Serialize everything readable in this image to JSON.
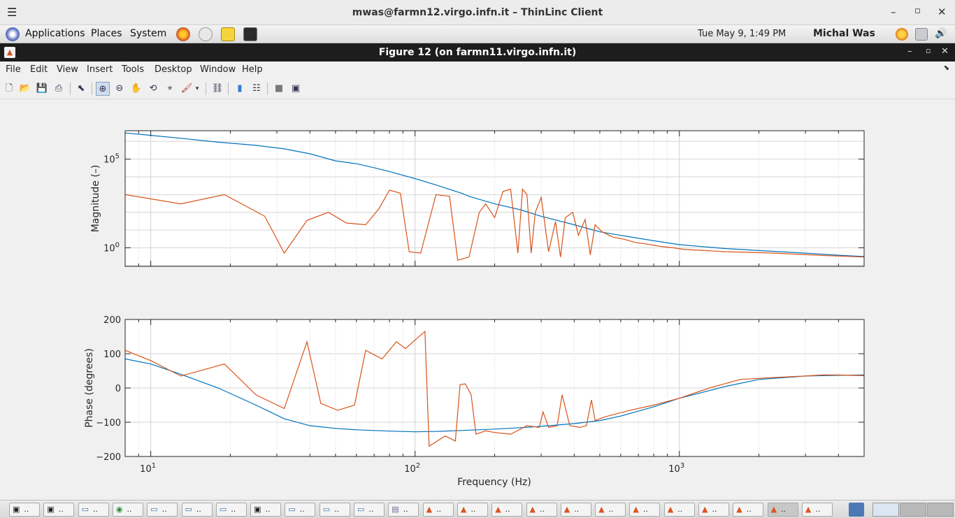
{
  "titlebar": {
    "title": "mwas@farmn12.virgo.infn.it – ThinLinc Client",
    "menu_glyph": "☰",
    "minimize": "–",
    "maximize": "▫",
    "close": "✕"
  },
  "panel": {
    "applications": "Applications",
    "places": "Places",
    "system": "System",
    "clock": "Tue May  9,  1:49 PM",
    "user": "Michal Was",
    "launchers": [
      "firefox-icon",
      "mail-icon",
      "notes-icon",
      "terminal-icon"
    ],
    "tray": [
      "weather-icon",
      "network-icon",
      "volume-icon"
    ]
  },
  "figure_window": {
    "title": "Figure 12 (on farmn11.virgo.infn.it)",
    "minimize": "–",
    "maximize": "▫",
    "close": "✕"
  },
  "menubar": {
    "items": [
      {
        "label": "File",
        "u": "F"
      },
      {
        "label": "Edit",
        "u": "E"
      },
      {
        "label": "View",
        "u": "V"
      },
      {
        "label": "Insert",
        "u": "I"
      },
      {
        "label": "Tools",
        "u": "T"
      },
      {
        "label": "Desktop",
        "u": "D"
      },
      {
        "label": "Window",
        "u": "W"
      },
      {
        "label": "Help",
        "u": "H"
      }
    ],
    "dock_glyph": "⬊"
  },
  "toolbar": {
    "buttons": [
      "new-figure",
      "open-file",
      "save",
      "print",
      "edit-plot",
      "zoom-in",
      "zoom-out",
      "pan",
      "rotate-3d",
      "data-cursor",
      "brush",
      "brush-menu",
      "link-plot",
      "colorbar",
      "legend",
      "hide-plot-tools",
      "show-plot-tools"
    ]
  },
  "colors": {
    "blue": "#0072bd",
    "orange": "#d95319",
    "grid": "#dcdcdc"
  },
  "chart_data": [
    {
      "type": "line",
      "xscale": "log",
      "yscale": "log",
      "xlim": [
        8,
        5000
      ],
      "ylim": [
        0.09,
        4000000
      ],
      "ylabel": "Magnitude (–)",
      "yticks": [
        {
          "value": 1,
          "base": "10",
          "exp": "0"
        },
        {
          "value": 100000,
          "base": "10",
          "exp": "5"
        }
      ],
      "grid": true,
      "series": [
        {
          "color": "#0072bd",
          "x": [
            8,
            10,
            13,
            18,
            25,
            32,
            40,
            50,
            60,
            70,
            80,
            100,
            120,
            150,
            160,
            200,
            250,
            300,
            400,
            500,
            600,
            800,
            1000,
            1500,
            2000,
            3000,
            4000,
            5000
          ],
          "y": [
            3000000,
            2200000,
            1500000,
            900000,
            600000,
            380000,
            200000,
            80000,
            55000,
            33000,
            20000,
            8000,
            3500,
            1200,
            800,
            300,
            140,
            60,
            20,
            8,
            5,
            2.5,
            1.5,
            0.9,
            0.7,
            0.5,
            0.38,
            0.32
          ]
        },
        {
          "color": "#d95319",
          "x": [
            8,
            13,
            19,
            27,
            32,
            39,
            47,
            55,
            65,
            73,
            80,
            88,
            95,
            105,
            120,
            135,
            145,
            160,
            175,
            185,
            200,
            215,
            230,
            245,
            255,
            265,
            275,
            285,
            300,
            320,
            340,
            355,
            370,
            395,
            415,
            440,
            460,
            480,
            510,
            560,
            620,
            680,
            760,
            850,
            950,
            1050,
            1250,
            1500,
            1900,
            2300,
            2900,
            3600,
            4300,
            5000
          ],
          "y": [
            1000,
            300,
            1000,
            60,
            0.5,
            35,
            100,
            25,
            20,
            160,
            1800,
            1200,
            0.6,
            0.5,
            1000,
            800,
            0.2,
            0.3,
            100,
            300,
            50,
            1500,
            2000,
            0.5,
            2000,
            1000,
            0.5,
            100,
            700,
            0.6,
            30,
            0.3,
            50,
            100,
            5,
            40,
            0.4,
            20,
            8,
            4,
            3,
            2,
            1.6,
            1.2,
            1.0,
            0.8,
            0.7,
            0.6,
            0.55,
            0.5,
            0.42,
            0.36,
            0.33,
            0.3
          ]
        }
      ]
    },
    {
      "type": "line",
      "xscale": "log",
      "xlim": [
        8,
        5000
      ],
      "ylim": [
        -200,
        200
      ],
      "xlabel": "Frequency (Hz)",
      "ylabel": "Phase (degrees)",
      "yticks": [
        {
          "value": -200,
          "label": "−200"
        },
        {
          "value": -100,
          "label": "−100"
        },
        {
          "value": 0,
          "label": "0"
        },
        {
          "value": 100,
          "label": "100"
        },
        {
          "value": 200,
          "label": "200"
        }
      ],
      "xticks": [
        {
          "value": 10,
          "base": "10",
          "exp": "1"
        },
        {
          "value": 100,
          "base": "10",
          "exp": "2"
        },
        {
          "value": 1000,
          "base": "10",
          "exp": "3"
        }
      ],
      "grid": true,
      "series": [
        {
          "color": "#0072bd",
          "x": [
            8,
            10,
            13,
            18,
            25,
            32,
            40,
            50,
            60,
            80,
            100,
            120,
            150,
            200,
            250,
            300,
            400,
            500,
            600,
            800,
            1000,
            1500,
            2000,
            3000,
            4000,
            5000
          ],
          "y": [
            85,
            70,
            40,
            0,
            -50,
            -90,
            -110,
            -118,
            -122,
            -126,
            -128,
            -127,
            -124,
            -120,
            -116,
            -112,
            -104,
            -95,
            -82,
            -55,
            -30,
            5,
            25,
            35,
            37,
            38
          ]
        },
        {
          "color": "#d95319",
          "x": [
            8,
            10,
            13,
            19,
            25,
            32,
            39,
            44,
            51,
            59,
            65,
            75,
            85,
            92,
            100,
            109,
            113,
            130,
            142,
            148,
            155,
            163,
            170,
            185,
            200,
            230,
            265,
            295,
            305,
            320,
            345,
            360,
            385,
            420,
            445,
            465,
            480,
            520,
            650,
            800,
            1000,
            1300,
            1700,
            2200,
            3000,
            3500,
            4000,
            5000
          ],
          "y": [
            110,
            80,
            35,
            70,
            -20,
            -60,
            135,
            -45,
            -65,
            -50,
            110,
            85,
            135,
            115,
            140,
            165,
            -170,
            -140,
            -155,
            10,
            12,
            -20,
            -135,
            -125,
            -130,
            -135,
            -110,
            -115,
            -70,
            -115,
            -110,
            -20,
            -110,
            -115,
            -110,
            -35,
            -95,
            -85,
            -65,
            -50,
            -30,
            0,
            25,
            30,
            35,
            38,
            38,
            36
          ]
        }
      ]
    }
  ],
  "taskbar": {
    "tasks": [
      {
        "icon": "terminal-icon",
        "label": ".."
      },
      {
        "icon": "terminal-icon",
        "label": ".."
      },
      {
        "icon": "window-icon",
        "label": ".."
      },
      {
        "icon": "browser-icon",
        "label": ".."
      },
      {
        "icon": "window-icon",
        "label": ".."
      },
      {
        "icon": "window-icon",
        "label": ".."
      },
      {
        "icon": "window-icon",
        "label": ".."
      },
      {
        "icon": "terminal-icon",
        "label": ".."
      },
      {
        "icon": "window-icon",
        "label": ".."
      },
      {
        "icon": "window-icon",
        "label": ".."
      },
      {
        "icon": "window-icon",
        "label": ".."
      },
      {
        "icon": "doc-icon",
        "label": ".."
      },
      {
        "icon": "matlab-icon",
        "label": ".."
      },
      {
        "icon": "matlab-icon",
        "label": ".."
      },
      {
        "icon": "matlab-icon",
        "label": ".."
      },
      {
        "icon": "matlab-icon",
        "label": ".."
      },
      {
        "icon": "matlab-icon",
        "label": ".."
      },
      {
        "icon": "matlab-icon",
        "label": ".."
      },
      {
        "icon": "matlab-icon",
        "label": ".."
      },
      {
        "icon": "matlab-icon",
        "label": ".."
      },
      {
        "icon": "matlab-icon",
        "label": ".."
      },
      {
        "icon": "matlab-icon",
        "label": ".."
      },
      {
        "icon": "matlab-icon",
        "label": ".."
      },
      {
        "icon": "matlab-icon",
        "label": ".."
      }
    ]
  }
}
